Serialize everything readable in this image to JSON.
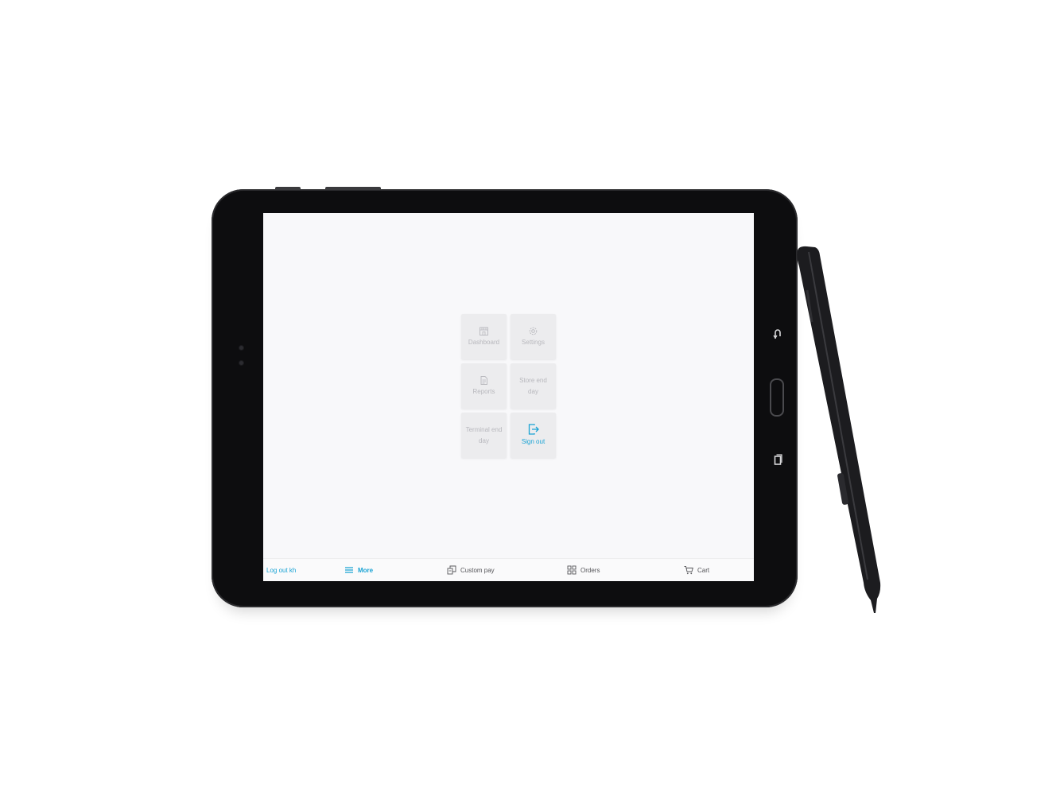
{
  "menu": {
    "tiles": [
      {
        "label": "Dashboard",
        "icon": "store-icon"
      },
      {
        "label": "Settings",
        "icon": "gear-icon"
      },
      {
        "label": "Reports",
        "icon": "report-icon"
      },
      {
        "label": "Store end day",
        "icon": ""
      },
      {
        "label": "Terminal end day",
        "icon": ""
      },
      {
        "label": "Sign out",
        "icon": "sign-out-icon"
      }
    ]
  },
  "bottombar": {
    "logout": "Log out kh",
    "more": "More",
    "custom_pay": "Custom pay",
    "orders": "Orders",
    "cart": "Cart"
  },
  "colors": {
    "accent": "#1aa3d4",
    "tile_bg": "#ececee",
    "screen_bg": "#f8f8fa",
    "muted_text": "#b8b8bd"
  }
}
